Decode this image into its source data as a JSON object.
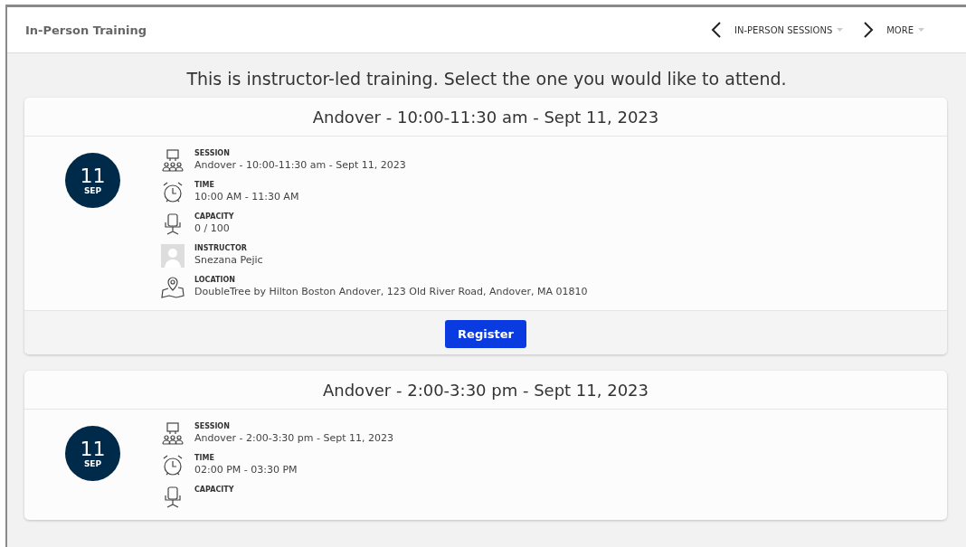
{
  "header": {
    "title": "In-Person Training",
    "nav": [
      {
        "kind": "prev"
      },
      {
        "kind": "menu",
        "label": "IN-PERSON SESSIONS"
      },
      {
        "kind": "next"
      },
      {
        "kind": "menu",
        "label": "MORE"
      }
    ]
  },
  "intro": "This is instructor-led training. Select the one you would like to attend.",
  "sessions": [
    {
      "title": "Andover - 10:00-11:30 am - Sept 11, 2023",
      "day": "11",
      "month": "SEP",
      "details": [
        {
          "kind": "session",
          "label": "SESSION",
          "value": "Andover - 10:00-11:30 am - Sept 11, 2023"
        },
        {
          "kind": "time",
          "label": "TIME",
          "value": "10:00 AM - 11:30 AM"
        },
        {
          "kind": "capacity",
          "label": "CAPACITY",
          "value": "0 / 100"
        },
        {
          "kind": "instructor",
          "label": "INSTRUCTOR",
          "value": "Snezana Pejic"
        },
        {
          "kind": "location",
          "label": "LOCATION",
          "value": "DoubleTree by Hilton Boston Andover, 123 Old River Road, Andover, MA 01810"
        }
      ],
      "button": "Register"
    },
    {
      "title": "Andover - 2:00-3:30 pm - Sept 11, 2023",
      "day": "11",
      "month": "SEP",
      "details": [
        {
          "kind": "session",
          "label": "SESSION",
          "value": "Andover - 2:00-3:30 pm - Sept 11, 2023"
        },
        {
          "kind": "time",
          "label": "TIME",
          "value": "02:00 PM - 03:30 PM"
        },
        {
          "kind": "capacity",
          "label": "CAPACITY"
        }
      ]
    }
  ]
}
